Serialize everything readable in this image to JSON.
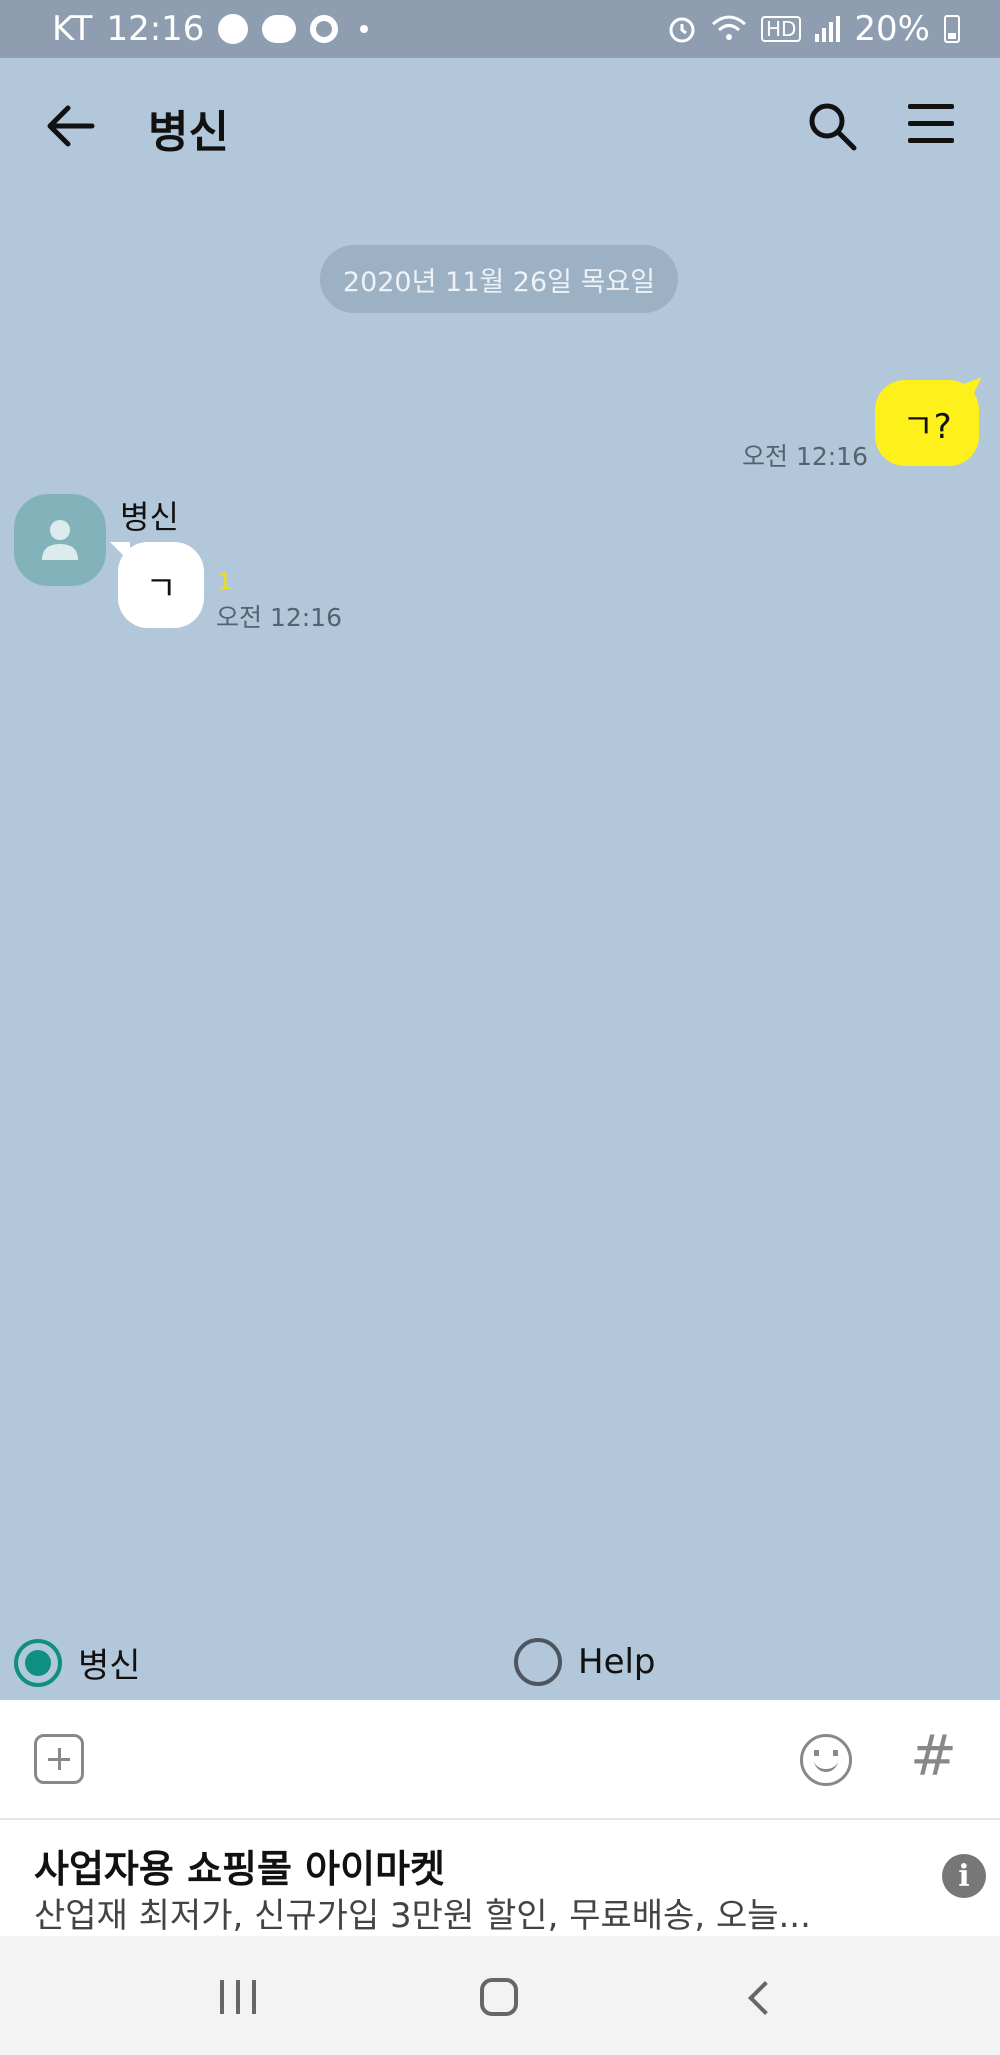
{
  "status_bar": {
    "carrier": "KT",
    "time": "12:16",
    "hd_label": "HD",
    "battery_percent": "20%"
  },
  "header": {
    "title": "병신"
  },
  "chat": {
    "date_divider": "2020년 11월 26일 목요일",
    "messages": [
      {
        "sender": "me",
        "text": "ㄱ?",
        "time": "오전 12:16"
      },
      {
        "sender": "병신",
        "text": "ㄱ",
        "time": "오전 12:16",
        "unread": "1"
      }
    ]
  },
  "selector": {
    "options": [
      {
        "label": "병신",
        "selected": true
      },
      {
        "label": "Help",
        "selected": false
      }
    ]
  },
  "input_bar": {
    "hash_label": "#"
  },
  "ad": {
    "title": "사업자용 쇼핑몰 아이마켓",
    "description": "산업재 최저가, 신규가입 3만원 할인, 무료배송, 오늘...",
    "info_label": "i"
  },
  "colors": {
    "chat_background": "#b2c7da",
    "my_bubble": "#fef01b",
    "other_bubble": "#ffffff",
    "radio_accent": "#0e8f82"
  }
}
